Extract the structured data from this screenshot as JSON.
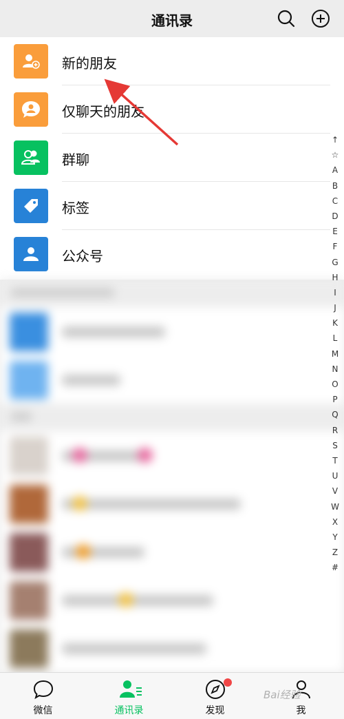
{
  "header": {
    "title": "通讯录",
    "search_icon": "search-icon",
    "add_icon": "plus-circle-icon"
  },
  "menu": [
    {
      "label": "新的朋友",
      "color": "#fa9d3b",
      "icon": "add-friend-icon"
    },
    {
      "label": "仅聊天的朋友",
      "color": "#fa9d3b",
      "icon": "chat-bubble-person-icon"
    },
    {
      "label": "群聊",
      "color": "#07c160",
      "icon": "group-icon"
    },
    {
      "label": "标签",
      "color": "#2782d7",
      "icon": "tag-icon"
    },
    {
      "label": "公众号",
      "color": "#2782d7",
      "icon": "person-icon"
    }
  ],
  "index_letters": [
    "↑",
    "☆",
    "A",
    "B",
    "C",
    "D",
    "E",
    "F",
    "G",
    "H",
    "I",
    "J",
    "K",
    "L",
    "M",
    "N",
    "O",
    "P",
    "Q",
    "R",
    "S",
    "T",
    "U",
    "V",
    "W",
    "X",
    "Y",
    "Z",
    "#"
  ],
  "tabs": [
    {
      "label": "微信",
      "icon": "chat-icon",
      "active": false
    },
    {
      "label": "通讯录",
      "icon": "contacts-icon",
      "active": true
    },
    {
      "label": "发现",
      "icon": "compass-icon",
      "active": false
    },
    {
      "label": "我",
      "icon": "person-icon",
      "active": false
    }
  ],
  "watermark": "Bai经验"
}
